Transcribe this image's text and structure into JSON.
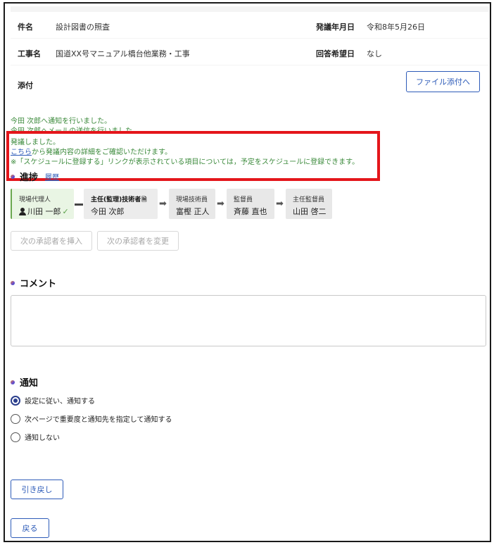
{
  "info": {
    "subject_label": "件名",
    "subject_value": "設計図書の照査",
    "issue_date_label": "発議年月日",
    "issue_date_value": "令和8年5月26日",
    "project_label": "工事名",
    "project_value": "国道XX号マニュアル橋台他業務・工事",
    "reply_date_label": "回答希望日",
    "reply_date_value": "なし",
    "attachment_label": "添付",
    "attach_button": "ファイル添付へ"
  },
  "messages": {
    "line1": "今田 次郎へ通知を行いました。",
    "line2": "今田 次郎へメールの送信を行いました。",
    "line3": "発議しました。",
    "line4_link": "こちら",
    "line4_rest": "から発議内容の詳細をご確認いただけます。",
    "line5": "※「スケジュールに登録する」リンクが表示されている項目については，予定をスケジュールに登録できます。"
  },
  "progress": {
    "title": "進捗",
    "history_link": "履歴",
    "steps": [
      {
        "role": "現場代理人",
        "name": "川田 一郎",
        "status": "done"
      },
      {
        "role": "主任(監理)技術者",
        "name": "今田 次郎",
        "status": "current"
      },
      {
        "role": "現場技術員",
        "name": "富樫 正人",
        "status": "pending"
      },
      {
        "role": "監督員",
        "name": "斉藤 直也",
        "status": "pending"
      },
      {
        "role": "主任監督員",
        "name": "山田 啓二",
        "status": "pending"
      }
    ],
    "insert_button": "次の承認者を挿入",
    "change_button": "次の承認者を変更"
  },
  "comment": {
    "title": "コメント",
    "value": ""
  },
  "notify": {
    "title": "通知",
    "options": [
      {
        "label": "設定に従い、通知する",
        "checked": true
      },
      {
        "label": "次ページで重要度と通知先を指定して通知する",
        "checked": false
      },
      {
        "label": "通知しない",
        "checked": false
      }
    ]
  },
  "actions": {
    "withdraw_button": "引き戻し",
    "back_button": "戻る"
  },
  "colors": {
    "accent": "#2d5bb8",
    "success_text": "#3b8a3b",
    "highlight": "#e4161b"
  }
}
